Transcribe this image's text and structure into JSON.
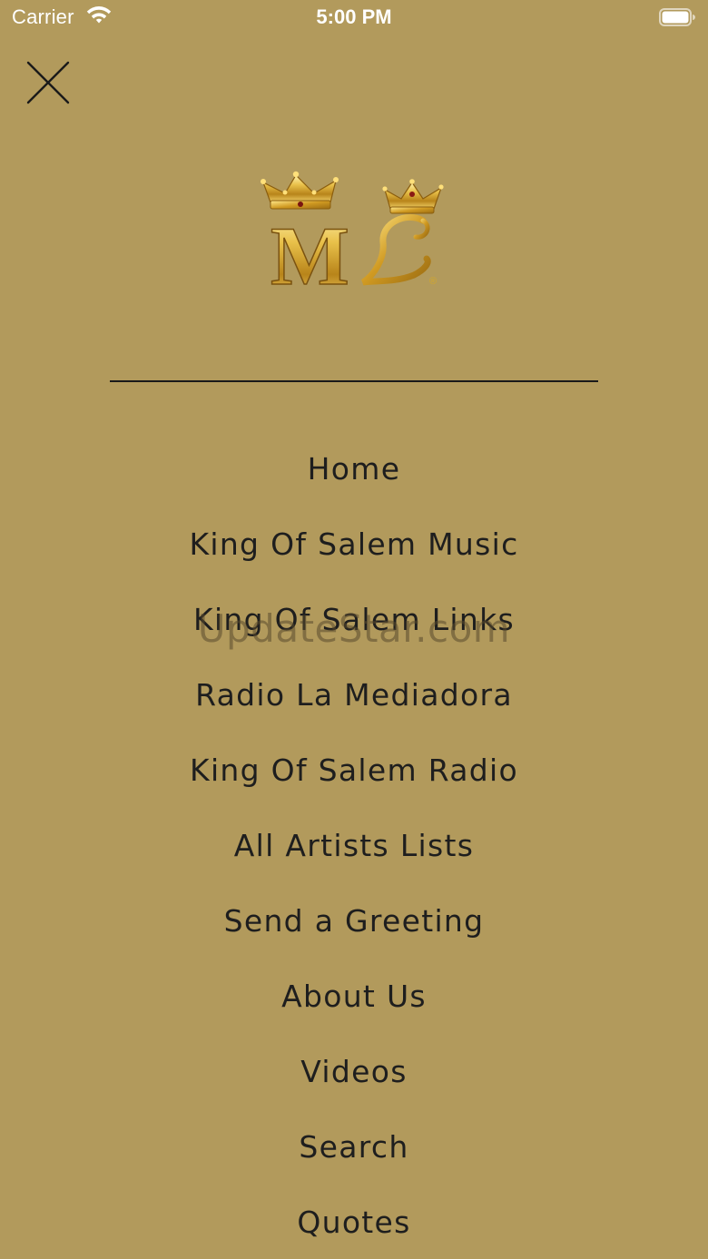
{
  "status_bar": {
    "carrier": "Carrier",
    "time": "5:00 PM",
    "wifi_icon": "wifi-icon",
    "battery_icon": "battery-icon"
  },
  "close_icon": "close-icon",
  "logo": {
    "monogram_text": "ML",
    "registered_mark": "®",
    "icon": "crown-logo-icon"
  },
  "menu": {
    "items": [
      {
        "label": "Home"
      },
      {
        "label": "King Of Salem Music"
      },
      {
        "label": "King Of Salem Links"
      },
      {
        "label": "Radio La Mediadora"
      },
      {
        "label": "King Of Salem Radio"
      },
      {
        "label": "All Artists Lists"
      },
      {
        "label": "Send a Greeting"
      },
      {
        "label": "About Us"
      },
      {
        "label": "Videos"
      },
      {
        "label": "Search"
      },
      {
        "label": "Quotes"
      }
    ]
  },
  "watermark": "UpdateStar.com",
  "colors": {
    "background": "#b29a5c",
    "text": "#1e1e1e",
    "gold": "#d4a829"
  }
}
